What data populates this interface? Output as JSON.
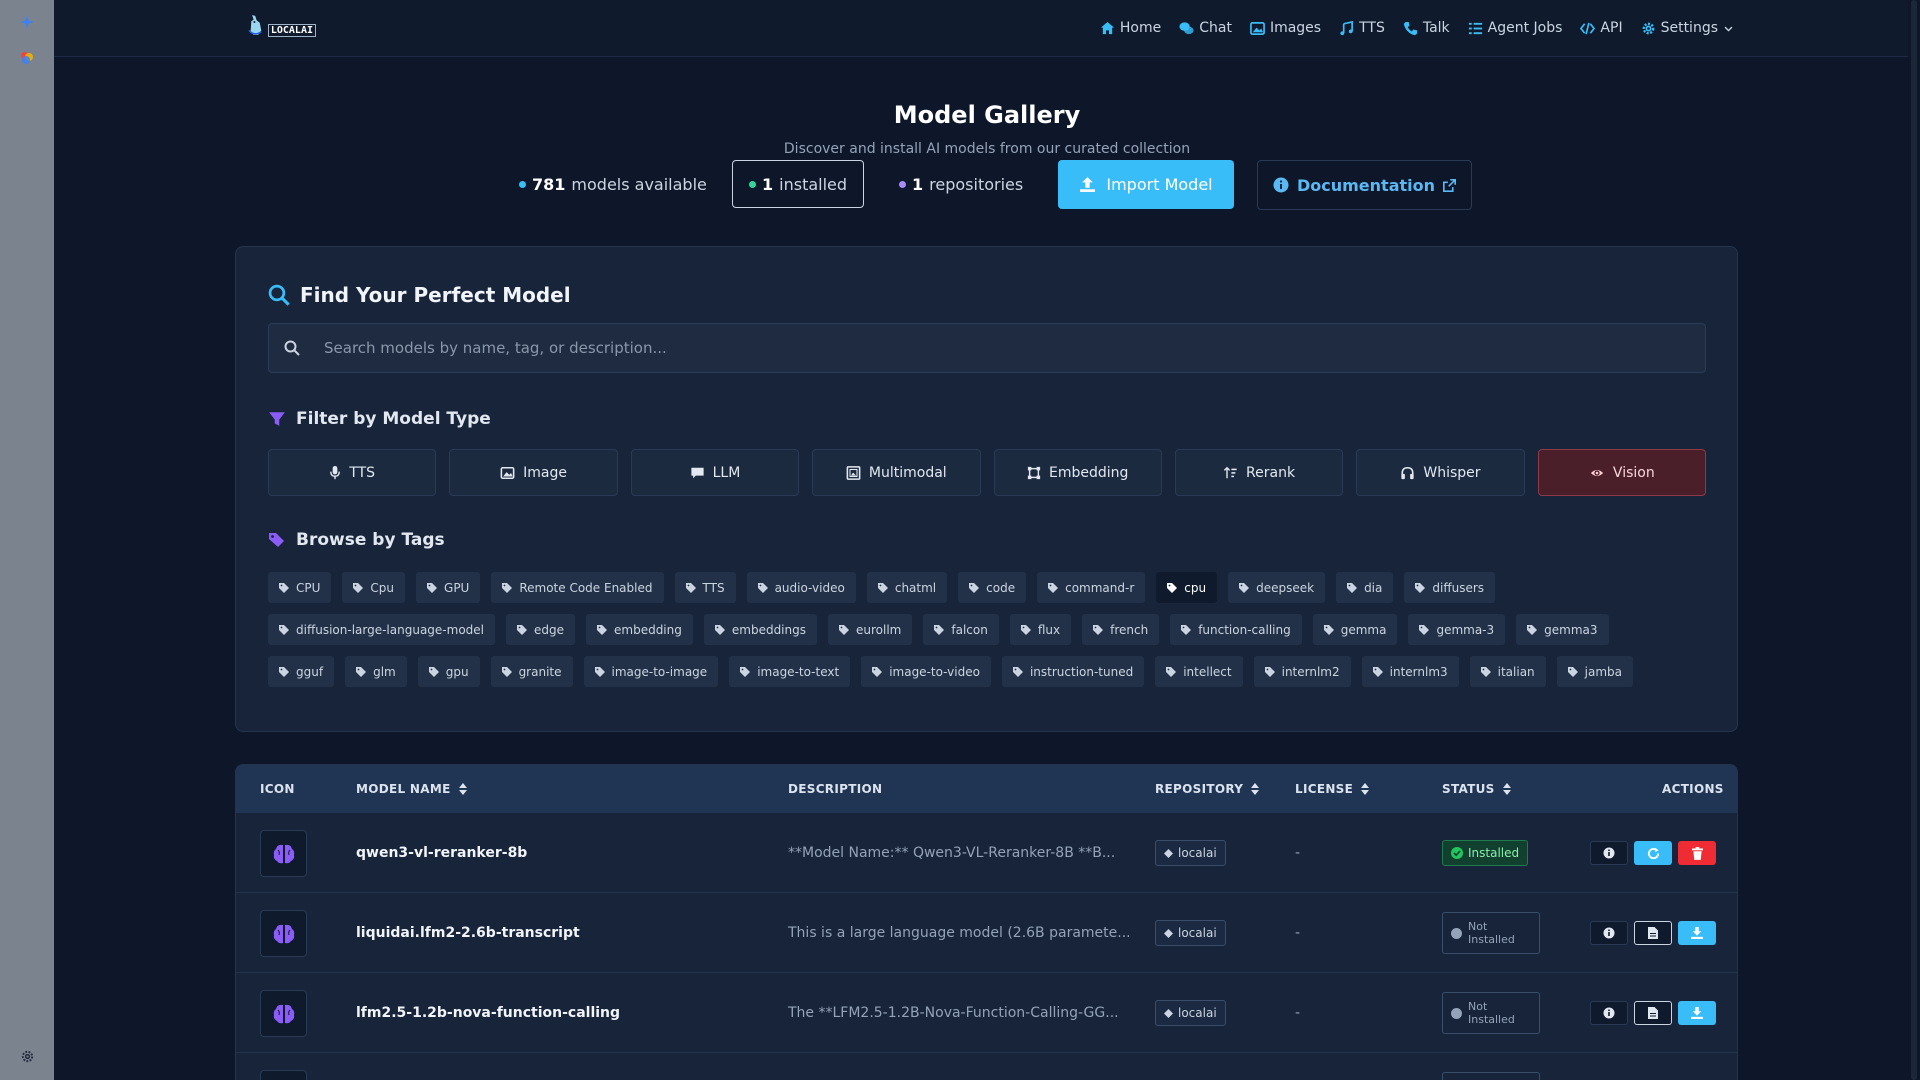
{
  "rail": {
    "top_icon": "sparkle-icon",
    "second_icon": "palette-icon",
    "bottom_icon": "gear-icon"
  },
  "nav": {
    "logo_text": "LOCALAI",
    "links": [
      {
        "label": "Home",
        "icon": "home-icon"
      },
      {
        "label": "Chat",
        "icon": "chat-icon"
      },
      {
        "label": "Images",
        "icon": "image-icon"
      },
      {
        "label": "TTS",
        "icon": "music-icon"
      },
      {
        "label": "Talk",
        "icon": "phone-icon"
      },
      {
        "label": "Agent Jobs",
        "icon": "list-icon"
      },
      {
        "label": "API",
        "icon": "code-icon"
      },
      {
        "label": "Settings",
        "icon": "gear-icon"
      }
    ]
  },
  "header": {
    "title": "Model Gallery",
    "subtitle": "Discover and install AI models from our curated collection",
    "stats": {
      "models_count": "781",
      "models_label": "models available",
      "installed_count": "1",
      "installed_label": "installed",
      "repos_count": "1",
      "repos_label": "repositories"
    },
    "import_label": "Import Model",
    "docs_label": "Documentation"
  },
  "search": {
    "heading": "Find Your Perfect Model",
    "placeholder": "Search models by name, tag, or description...",
    "value": ""
  },
  "filter": {
    "heading": "Filter by Model Type",
    "types": [
      {
        "label": "TTS",
        "icon": "microphone-icon",
        "active": false
      },
      {
        "label": "Image",
        "icon": "image-icon",
        "active": false
      },
      {
        "label": "LLM",
        "icon": "comment-icon",
        "active": false
      },
      {
        "label": "Multimodal",
        "icon": "photo-film-icon",
        "active": false
      },
      {
        "label": "Embedding",
        "icon": "vector-icon",
        "active": false
      },
      {
        "label": "Rerank",
        "icon": "sort-icon",
        "active": false
      },
      {
        "label": "Whisper",
        "icon": "headphones-icon",
        "active": false
      },
      {
        "label": "Vision",
        "icon": "eye-icon",
        "active": true
      }
    ]
  },
  "tags": {
    "heading": "Browse by Tags",
    "rows": [
      [
        "CPU",
        "Cpu",
        "GPU",
        "Remote Code Enabled",
        "TTS",
        "audio-video",
        "chatml",
        "code",
        "command-r",
        "cpu",
        "deepseek",
        "dia",
        "diffusers"
      ],
      [
        "diffusion-large-language-model",
        "edge",
        "embedding",
        "embeddings",
        "eurollm",
        "falcon",
        "flux",
        "french",
        "function-calling",
        "gemma",
        "gemma-3",
        "gemma3"
      ],
      [
        "gguf",
        "glm",
        "gpu",
        "granite",
        "image-to-image",
        "image-to-text",
        "image-to-video",
        "instruction-tuned",
        "intellect",
        "internlm2",
        "internlm3",
        "italian",
        "jamba"
      ]
    ],
    "highlighted": "cpu"
  },
  "table": {
    "headers": {
      "icon": "ICON",
      "name": "MODEL NAME",
      "description": "DESCRIPTION",
      "repository": "REPOSITORY",
      "license": "LICENSE",
      "status": "STATUS",
      "actions": "ACTIONS"
    },
    "rows": [
      {
        "name": "qwen3-vl-reranker-8b",
        "description": "**Model Name:** Qwen3-VL-Reranker-8B **B...",
        "repository": "localai",
        "license": "-",
        "status": "Installed",
        "installed": true
      },
      {
        "name": "liquidai.lfm2-2.6b-transcript",
        "description": "This is a large language model (2.6B paramete...",
        "repository": "localai",
        "license": "-",
        "status": "Not Installed",
        "installed": false
      },
      {
        "name": "lfm2.5-1.2b-nova-function-calling",
        "description": "The **LFM2.5-1.2B-Nova-Function-Calling-GG...",
        "repository": "localai",
        "license": "-",
        "status": "Not Installed",
        "installed": false
      }
    ]
  },
  "colors": {
    "accent": "#38bdf8",
    "danger": "#ef2b33",
    "success": "#86efac",
    "vision_active": "#4a1f2a"
  }
}
